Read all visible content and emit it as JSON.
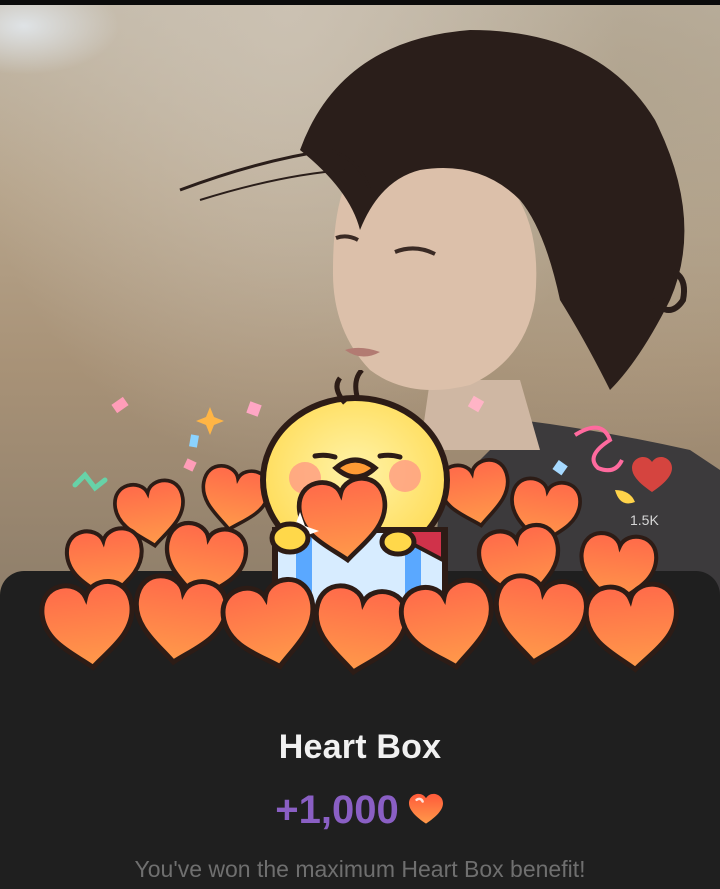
{
  "background": {
    "like_count": "1.5K",
    "like_icon": "heart-icon"
  },
  "popup": {
    "title": "Heart Box",
    "reward_amount": "+1,000",
    "reward_icon": "heart-icon",
    "message": "You've won the maximum Heart Box benefit!",
    "illustration": "chick-with-heart-pile",
    "accent_color": "#8a5fc4",
    "heart_color": "#ff5a3a",
    "sheet_color": "#1f1f1f"
  }
}
